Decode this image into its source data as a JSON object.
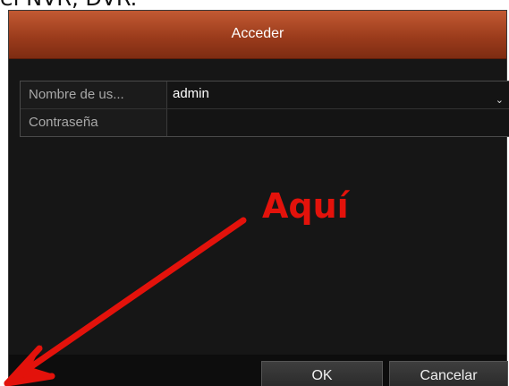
{
  "caption": "el NVR, DVR.",
  "dialog": {
    "title": "Acceder",
    "form": {
      "username_label": "Nombre de us...",
      "username_value": "admin",
      "password_label": "Contraseña",
      "password_value": ""
    },
    "buttons": {
      "ok": "OK",
      "cancel": "Cancelar"
    }
  },
  "annotation": {
    "text": "Aquí",
    "color": "#e3120b"
  },
  "icons": {
    "dropdown": "chevron-down-icon"
  }
}
